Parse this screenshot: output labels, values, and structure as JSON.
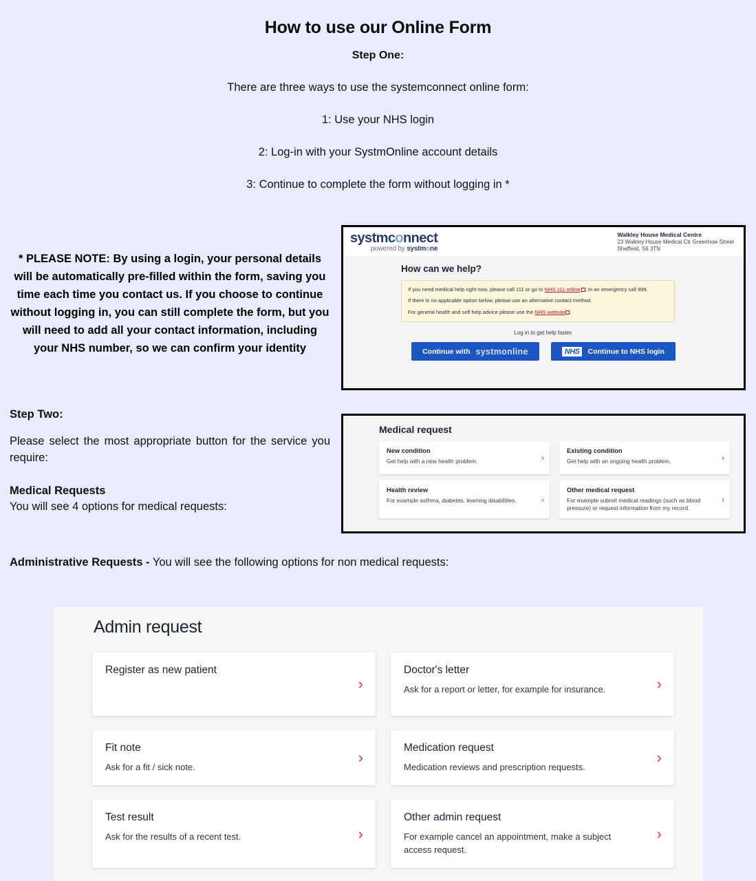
{
  "page": {
    "background_color": "#e9ecfd",
    "title": "How to use our Online Form",
    "step_one_label": "Step One:",
    "intro_lines": [
      "There are three ways to use the systemconnect online form:",
      "1: Use your NHS login",
      "2: Log-in with your SystmOnline account details",
      "3: Continue to complete the form without logging in *"
    ],
    "please_note": "* PLEASE NOTE: By using a login, your personal details will be automatically pre-filled within the form, saving you time each time you contact us. If you choose to continue without logging in, you can still complete the form, but you will need to add all your contact information, including your NHS number, so we can confirm your identity",
    "step_two_label": "Step Two:",
    "step_two_text": "Please select the most appropriate button for the service you require:",
    "medical_requests_heading": "Medical Requests",
    "medical_requests_text": "You will see  4 options for medical requests:",
    "admin_requests_heading": "Administrative Requests -",
    "admin_requests_text": " You will see the following options for non medical requests:"
  },
  "systmconnect": {
    "logo_main_pre": "systmc",
    "logo_main_o": "o",
    "logo_main_post": "nnect",
    "logo_sub_prefix": "powered by ",
    "logo_sub_brand_pre": "systm",
    "logo_sub_brand_o": "o",
    "logo_sub_brand_post": "ne",
    "practice_name": "Walkley House Medical Centre",
    "practice_address_line1": "23 Walkley House Medical Ctr Greenhow Street",
    "practice_address_line2": "Sheffield, S6 3TN",
    "heading": "How can we help?",
    "notice": {
      "line1_a": "If you need medical help right now, please call 111 or go to ",
      "line1_link": "NHS 111 online",
      "line1_b": ". In an emergency call 999.",
      "line2": "If there is no applicable option below, please use an alternative contact method.",
      "line3_a": "For general health and self help advice please use the ",
      "line3_link": "NHS website",
      "line3_b": ".",
      "background_color": "#fbf7dc",
      "link_color": "#c8102e"
    },
    "login_prompt": "Log in to get help faster.",
    "button_systmonline_prefix": "Continue with ",
    "button_systmonline_brand": "systmonline",
    "button_nhs_logo": "NHS",
    "button_nhs_label": "Continue to NHS login",
    "button_color": "#1a56c4"
  },
  "medical_request": {
    "title": "Medical request",
    "chevron_color": "#e0345a",
    "options": [
      {
        "title": "New condition",
        "desc": "Get help with a new health problem."
      },
      {
        "title": "Existing condition",
        "desc": "Get help with an ongoing health problem."
      },
      {
        "title": "Health review",
        "desc": "For example asthma, diabetes, learning disabilities."
      },
      {
        "title": "Other medical request",
        "desc": "For example submit medical readings (such as blood pressure) or request information from my record."
      }
    ]
  },
  "admin_request": {
    "title": "Admin request",
    "chevron_color": "#e0345a",
    "options": [
      {
        "title": "Register as new patient",
        "desc": ""
      },
      {
        "title": "Doctor's letter",
        "desc": "Ask for a report or letter, for example for insurance."
      },
      {
        "title": "Fit note",
        "desc": "Ask for a fit / sick note."
      },
      {
        "title": "Medication request",
        "desc": "Medication reviews and prescription requests."
      },
      {
        "title": "Test result",
        "desc": "Ask for the results of a recent test."
      },
      {
        "title": "Other admin request",
        "desc": "For example cancel an appointment, make a subject access request."
      }
    ]
  }
}
